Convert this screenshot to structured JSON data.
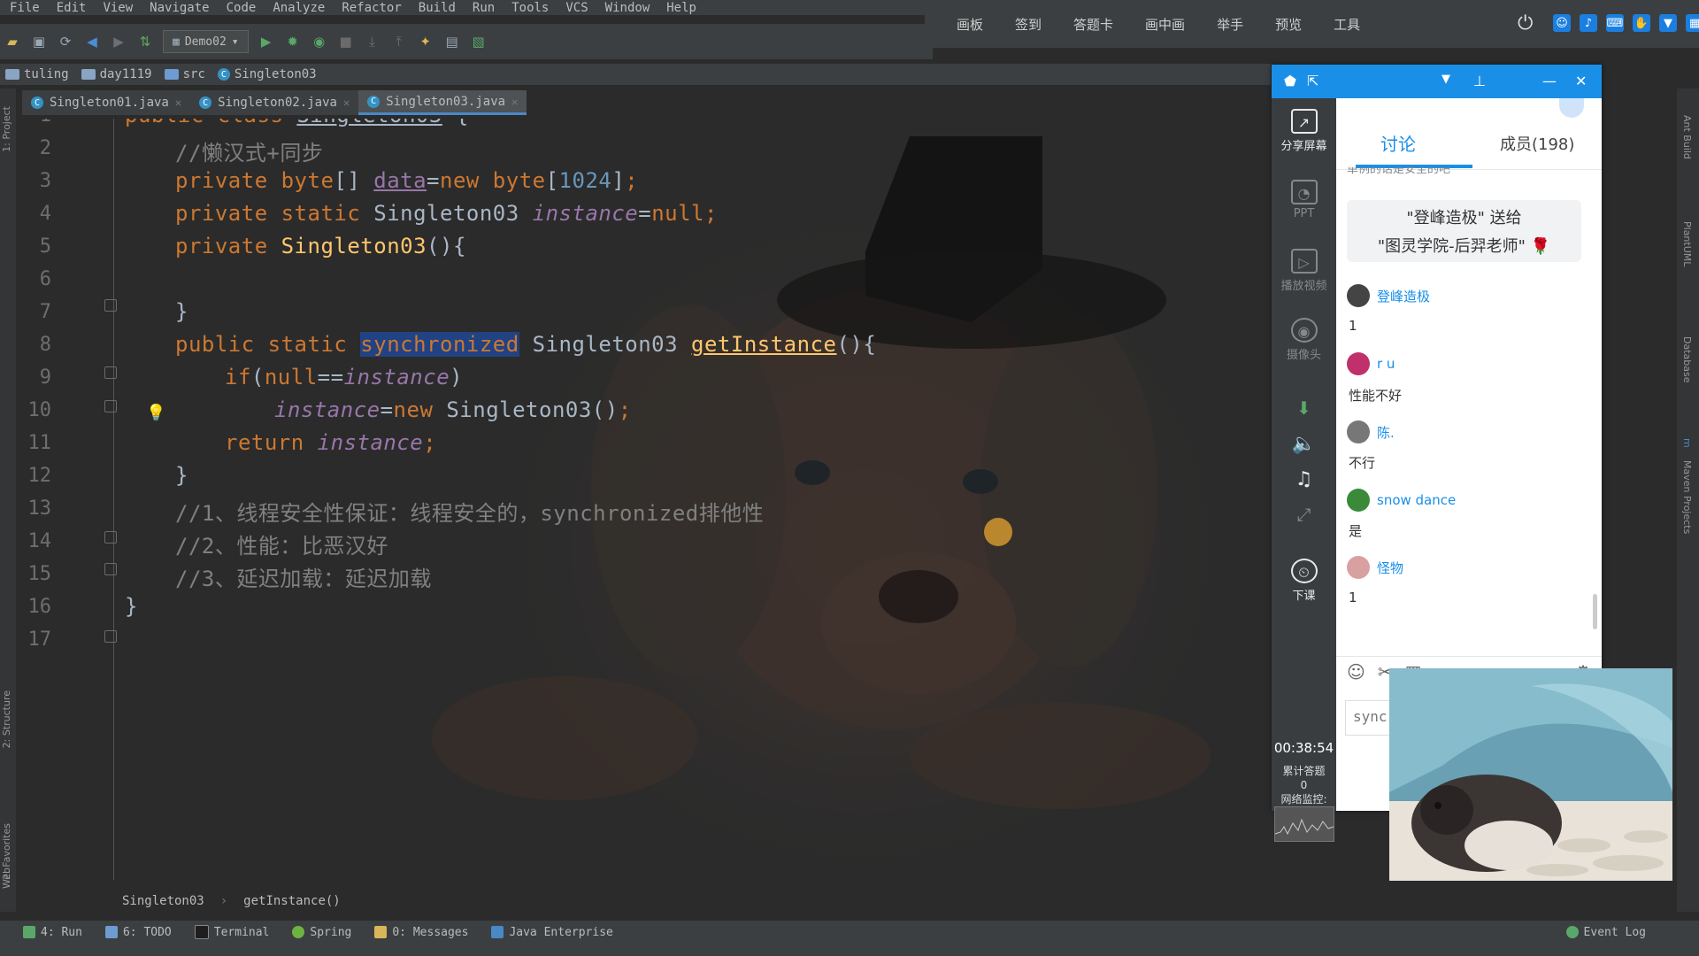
{
  "menu": [
    "File",
    "Edit",
    "View",
    "Navigate",
    "Code",
    "Analyze",
    "Refactor",
    "Build",
    "Run",
    "Tools",
    "VCS",
    "Window",
    "Help"
  ],
  "toolbar": {
    "run_config": "Demo02"
  },
  "class_topbar": [
    "画板",
    "签到",
    "答题卡",
    "画中画",
    "举手",
    "预览",
    "工具"
  ],
  "breadcrumb": [
    "tuling",
    "day1119",
    "src",
    "Singleton03"
  ],
  "tabs": [
    {
      "label": "Singleton01.java"
    },
    {
      "label": "Singleton02.java"
    },
    {
      "label": "Singleton03.java",
      "active": true
    }
  ],
  "editor": {
    "line_numbers": [
      "1",
      "2",
      "3",
      "4",
      "5",
      "6",
      "7",
      "8",
      "9",
      "10",
      "11",
      "12",
      "13",
      "14",
      "15",
      "16",
      "17"
    ],
    "comment_2": "//懒汉式+同步",
    "comment_13": "//1、线程安全性保证：线程安全的，synchronized排他性",
    "comment_14": "//2、性能：比恶汉好",
    "comment_15": "//3、延迟加载：延迟加载",
    "breadcrumb_class": "Singleton03",
    "breadcrumb_method": "getInstance()"
  },
  "bottom_tools": [
    "4: Run",
    "6: TODO",
    "Terminal",
    "Spring",
    "0: Messages",
    "Java Enterprise",
    "Event Log"
  ],
  "left_tools": [
    "1: Project",
    "2: Structure",
    "2: Favorites",
    "Web"
  ],
  "right_tools": [
    "Ant Build",
    "PlantUML",
    "Database",
    "m",
    "Maven Projects"
  ],
  "live": {
    "side_tools": [
      {
        "label": "分享屏幕",
        "icon": "share-screen-icon",
        "enabled": true
      },
      {
        "label": "PPT",
        "icon": "ppt-icon",
        "enabled": false
      },
      {
        "label": "播放视频",
        "icon": "play-video-icon",
        "enabled": false
      },
      {
        "label": "摄像头",
        "icon": "camera-icon",
        "enabled": false
      },
      {
        "label": "下课",
        "icon": "end-class-icon",
        "enabled": true
      }
    ],
    "timer": "00:38:54",
    "stats_line1": "累计答题",
    "stats_line2": "0",
    "stats_line3": "网络监控:",
    "tabs": {
      "discuss": "讨论",
      "members": "成员(198)"
    },
    "partial_text": "单例的话是安全的吧",
    "gift": {
      "line1": "\"登峰造极\" 送给",
      "line2": "\"图灵学院-后羿老师\""
    },
    "messages": [
      {
        "user": "登峰造极",
        "text": "1",
        "avatar": "#444444"
      },
      {
        "user": "r  u",
        "text": "性能不好",
        "avatar": "#c0306a"
      },
      {
        "user": "陈.",
        "text": "不行",
        "avatar": "#777777"
      },
      {
        "user": "snow dance",
        "text": "是",
        "avatar": "#3a8a3a"
      },
      {
        "user": "怪物",
        "text": "1",
        "avatar": "#d8a0a0"
      }
    ],
    "input_text": "sync"
  },
  "colors": {
    "accent": "#1a8fe8",
    "keyword": "#cc7832",
    "comment": "#808080",
    "number": "#6897bb",
    "field": "#9876aa",
    "selection": "#214283"
  }
}
